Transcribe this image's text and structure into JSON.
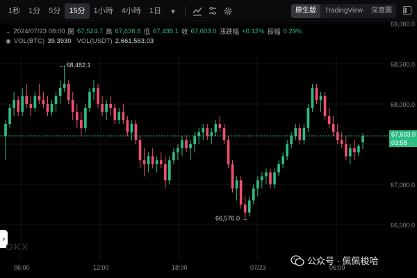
{
  "toolbar": {
    "intervals": [
      "1秒",
      "1分",
      "5分",
      "15分",
      "1小時",
      "4小時",
      "1日"
    ],
    "active_interval": "15分",
    "view_buttons": [
      "原生版",
      "TradingView",
      "深度圖"
    ],
    "active_view": "原生版"
  },
  "ohlc": {
    "datetime": "2024/07/23 08:00",
    "open_label": "開",
    "open": "67,524.7",
    "high_label": "高",
    "high": "67,636.8",
    "low_label": "低",
    "low": "67,438.1",
    "close_label": "收",
    "close": "67,603.0",
    "change_label": "漲跌幅",
    "change": "+0.12%",
    "amp_label": "振幅",
    "amp": "0.29%"
  },
  "volume": {
    "vol_btc_label": "VOL(BTC)",
    "vol_btc": "39.3930",
    "vol_usdt_label": "VOL(USDT)",
    "vol_usdt": "2,661,563.03"
  },
  "price_axis": [
    "69,000.0",
    "68,500.0",
    "68,000.0",
    "67,500.0",
    "67,000.0",
    "66,500.0"
  ],
  "time_axis": [
    "06:00",
    "12:00",
    "18:00",
    "07/23",
    "06:00"
  ],
  "last_price": {
    "price": "67,603.0",
    "countdown": "03:58"
  },
  "annotations": {
    "high": "← 68,482.1",
    "low": "66,576.0 →"
  },
  "watermark": {
    "text": "公众号 · 佩佩梭哈"
  },
  "logo": "OKX",
  "colors": {
    "up": "#2ebd85",
    "down": "#f0506e",
    "background": "#000000"
  },
  "chart_data": {
    "type": "candlestick",
    "interval": "15m",
    "x": [
      "06:00",
      "12:00",
      "18:00",
      "07/23",
      "06:00"
    ],
    "ylim": [
      66500,
      69000
    ],
    "candles": [
      [
        67600,
        67800,
        67300,
        67750
      ],
      [
        67750,
        68000,
        67700,
        67950
      ],
      [
        67950,
        68150,
        67850,
        68050
      ],
      [
        68050,
        68100,
        67850,
        67900
      ],
      [
        67900,
        68200,
        67850,
        68100
      ],
      [
        68100,
        68250,
        67950,
        68000
      ],
      [
        68000,
        68100,
        67850,
        67950
      ],
      [
        67950,
        68150,
        67900,
        68100
      ],
      [
        68100,
        68250,
        68000,
        68050
      ],
      [
        68050,
        68150,
        67950,
        68000
      ],
      [
        68000,
        68100,
        67850,
        67900
      ],
      [
        67900,
        68050,
        67850,
        68000
      ],
      [
        68000,
        68150,
        67900,
        68100
      ],
      [
        68100,
        68300,
        68000,
        68200
      ],
      [
        68200,
        68482,
        68150,
        68250
      ],
      [
        68250,
        68300,
        68000,
        68050
      ],
      [
        68050,
        68150,
        67800,
        67900
      ],
      [
        67900,
        68000,
        67700,
        67800
      ],
      [
        67800,
        67900,
        67600,
        67700
      ],
      [
        67700,
        68000,
        67650,
        67950
      ],
      [
        67950,
        68200,
        67900,
        68150
      ],
      [
        68150,
        68300,
        68050,
        68200
      ],
      [
        68200,
        68250,
        67950,
        68000
      ],
      [
        68000,
        68100,
        67850,
        67900
      ],
      [
        67900,
        68050,
        67800,
        68000
      ],
      [
        68000,
        68100,
        67850,
        67950
      ],
      [
        67950,
        68000,
        67750,
        67800
      ],
      [
        67800,
        67950,
        67750,
        67900
      ],
      [
        67900,
        68000,
        67750,
        67800
      ],
      [
        67800,
        67850,
        67600,
        67650
      ],
      [
        67650,
        67800,
        67550,
        67750
      ],
      [
        67750,
        67800,
        67500,
        67550
      ],
      [
        67550,
        67600,
        67200,
        67300
      ],
      [
        67300,
        67450,
        67100,
        67250
      ],
      [
        67250,
        67400,
        67150,
        67350
      ],
      [
        67350,
        67450,
        67200,
        67250
      ],
      [
        67250,
        67350,
        67150,
        67300
      ],
      [
        67300,
        67400,
        67200,
        67250
      ],
      [
        67250,
        67350,
        66950,
        67050
      ],
      [
        67050,
        67350,
        67000,
        67300
      ],
      [
        67300,
        67450,
        67250,
        67400
      ],
      [
        67400,
        67500,
        67300,
        67450
      ],
      [
        67450,
        67600,
        67350,
        67550
      ],
      [
        67550,
        67600,
        67400,
        67450
      ],
      [
        67450,
        67550,
        67300,
        67500
      ],
      [
        67500,
        67650,
        67400,
        67600
      ],
      [
        67600,
        67700,
        67500,
        67650
      ],
      [
        67650,
        67750,
        67550,
        67700
      ],
      [
        67700,
        67750,
        67550,
        67600
      ],
      [
        67600,
        67700,
        67500,
        67650
      ],
      [
        67650,
        67800,
        67600,
        67750
      ],
      [
        67750,
        67850,
        67650,
        67700
      ],
      [
        67700,
        67750,
        67500,
        67550
      ],
      [
        67550,
        67600,
        67200,
        67250
      ],
      [
        67250,
        67300,
        66900,
        66950
      ],
      [
        66950,
        67100,
        66800,
        67050
      ],
      [
        67050,
        67100,
        66700,
        66750
      ],
      [
        66750,
        66850,
        66576,
        66650
      ],
      [
        66650,
        66850,
        66600,
        66800
      ],
      [
        66800,
        67000,
        66750,
        66950
      ],
      [
        66950,
        67100,
        66850,
        67050
      ],
      [
        67050,
        67150,
        66950,
        67100
      ],
      [
        67100,
        67200,
        67000,
        67150
      ],
      [
        67150,
        67200,
        66950,
        67000
      ],
      [
        67000,
        67200,
        66950,
        67150
      ],
      [
        67150,
        67300,
        67100,
        67250
      ],
      [
        67250,
        67400,
        67200,
        67350
      ],
      [
        67350,
        67550,
        67300,
        67500
      ],
      [
        67500,
        67650,
        67450,
        67600
      ],
      [
        67600,
        67750,
        67550,
        67700
      ],
      [
        67700,
        67750,
        67500,
        67550
      ],
      [
        67550,
        67750,
        67500,
        67700
      ],
      [
        67700,
        68000,
        67650,
        67950
      ],
      [
        67950,
        68250,
        67900,
        68200
      ],
      [
        68200,
        68250,
        68000,
        68050
      ],
      [
        68050,
        68150,
        67900,
        68100
      ],
      [
        68100,
        68150,
        67800,
        67850
      ],
      [
        67850,
        67950,
        67700,
        67750
      ],
      [
        67750,
        67850,
        67600,
        67650
      ],
      [
        67650,
        67750,
        67500,
        67550
      ],
      [
        67550,
        67650,
        67450,
        67500
      ],
      [
        67500,
        67600,
        67300,
        67350
      ],
      [
        67350,
        67500,
        67250,
        67450
      ],
      [
        67450,
        67550,
        67300,
        67400
      ],
      [
        67400,
        67500,
        67350,
        67480
      ],
      [
        67524.7,
        67636.8,
        67438.1,
        67603.0
      ]
    ]
  }
}
